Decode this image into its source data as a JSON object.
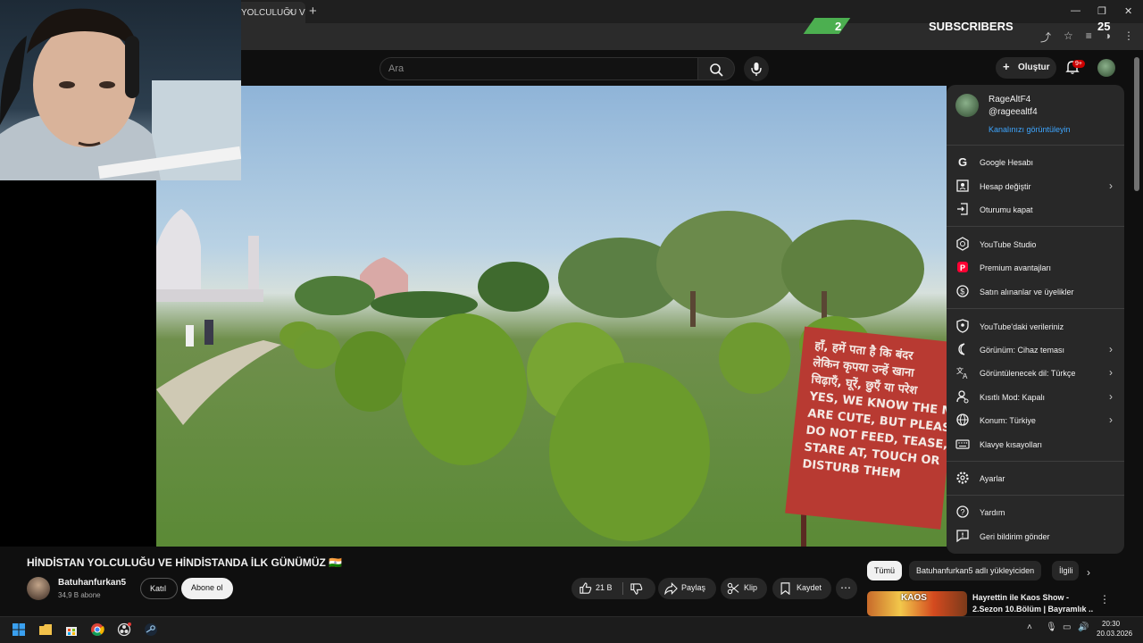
{
  "browser": {
    "tab_title": "YOLCULUĞU V",
    "tab_close": "×",
    "new_tab": "+",
    "window_controls": [
      "—",
      "❐",
      "✕"
    ]
  },
  "overlay": {
    "subscriber_count": "2",
    "subscriber_label": "SUBSCRIBERS",
    "subscriber_goal": "25"
  },
  "masthead": {
    "search_placeholder": "Ara",
    "create_label": "Oluştur",
    "notification_badge": "9+"
  },
  "menu": {
    "name": "RageAltF4",
    "handle": "@rageealtf4",
    "view_channel": "Kanalınızı görüntüleyin",
    "groups": [
      [
        {
          "label": "Google Hesabı",
          "icon": "google-icon",
          "chevron": false
        },
        {
          "label": "Hesap değiştir",
          "icon": "switch-account-icon",
          "chevron": true
        },
        {
          "label": "Oturumu kapat",
          "icon": "sign-out-icon",
          "chevron": false
        }
      ],
      [
        {
          "label": "YouTube Studio",
          "icon": "studio-icon",
          "chevron": false
        },
        {
          "label": "Premium avantajları",
          "icon": "premium-icon",
          "chevron": false
        },
        {
          "label": "Satın alınanlar ve üyelikler",
          "icon": "purchases-icon",
          "chevron": false
        }
      ],
      [
        {
          "label": "YouTube'daki verileriniz",
          "icon": "data-shield-icon",
          "chevron": false
        },
        {
          "label": "Görünüm: Cihaz teması",
          "icon": "moon-icon",
          "chevron": true
        },
        {
          "label": "Görüntülenecek dil: Türkçe",
          "icon": "language-icon",
          "chevron": true
        },
        {
          "label": "Kısıtlı Mod: Kapalı",
          "icon": "restricted-mode-icon",
          "chevron": true
        },
        {
          "label": "Konum: Türkiye",
          "icon": "globe-icon",
          "chevron": true
        },
        {
          "label": "Klavye kısayolları",
          "icon": "keyboard-icon",
          "chevron": false
        }
      ],
      [
        {
          "label": "Ayarlar",
          "icon": "settings-icon",
          "chevron": false
        }
      ],
      [
        {
          "label": "Yardım",
          "icon": "help-icon",
          "chevron": false
        },
        {
          "label": "Geri bildirim gönder",
          "icon": "feedback-icon",
          "chevron": false
        }
      ]
    ]
  },
  "video": {
    "title": "HİNDİSTAN YOLCULUĞU VE HİNDİSTANDA İLK GÜNÜMÜZ 🇮🇳",
    "channel": "Batuhanfurkan5",
    "subscribers": "34,9 B abone",
    "join_label": "Katıl",
    "subscribe_label": "Abone ol",
    "likes": "21 B",
    "share_label": "Paylaş",
    "clip_label": "Klip",
    "save_label": "Kaydet",
    "more_label": "⋯",
    "sign_lines": [
      "हाँ, हमें पता है कि बंदर",
      "लेकिन कृपया उन्हें खाना",
      "चिढ़ाएँ, घूरें, छुएँ या परेश",
      "YES, WE KNOW THE M",
      "ARE CUTE, BUT PLEAS",
      "DO NOT FEED, TEASE,",
      "STARE AT, TOUCH OR",
      "DISTURB THEM"
    ]
  },
  "sidebar": {
    "chips": [
      "Tümü",
      "Batuhanfurkan5 adlı yükleyiciden",
      "İlgili"
    ],
    "recommendation": {
      "thumb_text": "KAOS",
      "title_line1": "Hayrettin ile Kaos Show -",
      "title_line2": "2.Sezon 10.Bölüm | Bayramlık ..."
    }
  },
  "taskbar": {
    "time": "20:30",
    "date": "20.03.2026"
  }
}
